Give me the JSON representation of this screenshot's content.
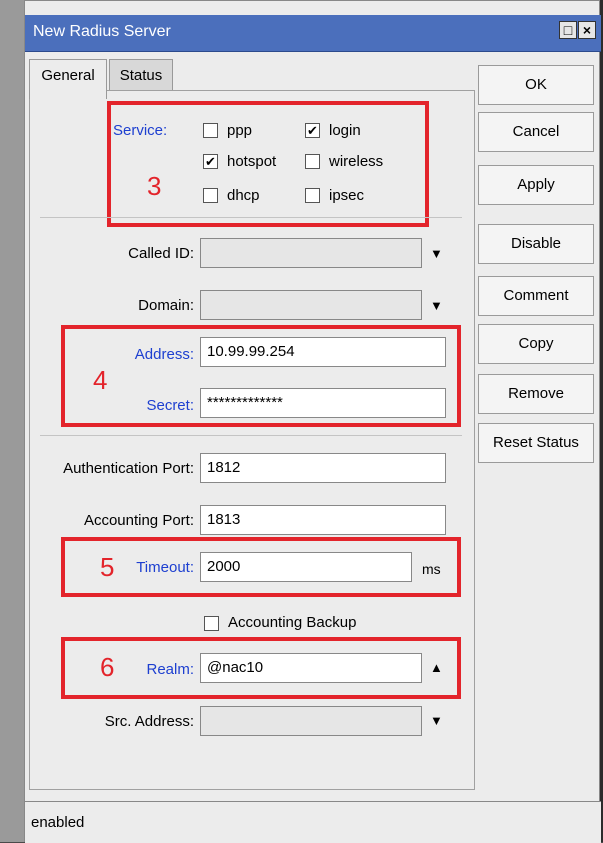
{
  "window": {
    "title": "New Radius Server",
    "controls": [
      "□",
      "×"
    ]
  },
  "tabs": [
    "General",
    "Status"
  ],
  "buttons": [
    "OK",
    "Cancel",
    "Apply",
    "Disable",
    "Comment",
    "Copy",
    "Remove",
    "Reset Status"
  ],
  "service": {
    "label": "Service:",
    "options": [
      {
        "label": "ppp",
        "checked": false
      },
      {
        "label": "login",
        "checked": true
      },
      {
        "label": "hotspot",
        "checked": true
      },
      {
        "label": "wireless",
        "checked": false
      },
      {
        "label": "dhcp",
        "checked": false
      },
      {
        "label": "ipsec",
        "checked": false
      }
    ]
  },
  "fields": {
    "called_id": {
      "label": "Called ID:",
      "value": ""
    },
    "domain": {
      "label": "Domain:",
      "value": ""
    },
    "address": {
      "label": "Address:",
      "value": "10.99.99.254"
    },
    "secret": {
      "label": "Secret:",
      "value": "*************"
    },
    "auth_port": {
      "label": "Authentication Port:",
      "value": "1812"
    },
    "acct_port": {
      "label": "Accounting Port:",
      "value": "1813"
    },
    "timeout": {
      "label": "Timeout:",
      "value": "2000",
      "unit": "ms"
    },
    "accounting_backup": {
      "label": "Accounting Backup",
      "checked": false
    },
    "realm": {
      "label": "Realm:",
      "value": "@nac10"
    },
    "src_address": {
      "label": "Src. Address:",
      "value": ""
    }
  },
  "annotations": [
    "3",
    "4",
    "5",
    "6"
  ],
  "status": {
    "text": "enabled"
  },
  "colors": {
    "annotation": "#e3242b",
    "titlebar": "#4b6fbc",
    "blue_label": "#1d3fd0"
  }
}
